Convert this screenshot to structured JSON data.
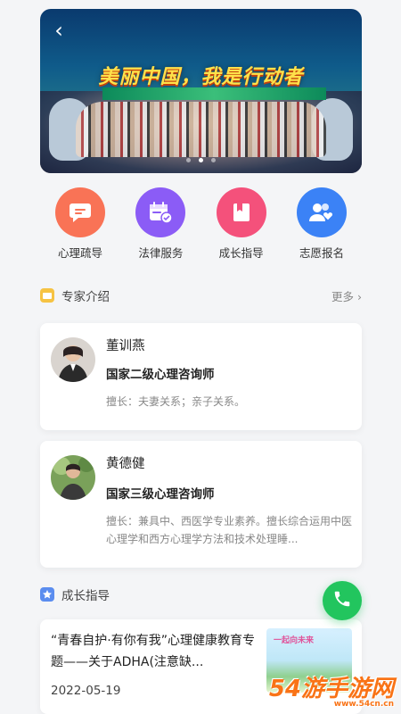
{
  "banner": {
    "title": "美丽中国，我是行动者",
    "back_icon": "chevron-left-icon",
    "slides": 3,
    "active_slide": 2
  },
  "services": [
    {
      "label": "心理疏导",
      "icon": "chat-bubble-icon",
      "color": "#f97356"
    },
    {
      "label": "法律服务",
      "icon": "calendar-check-icon",
      "color": "#8b5cf6"
    },
    {
      "label": "成长指导",
      "icon": "book-icon",
      "color": "#f4517b"
    },
    {
      "label": "志愿报名",
      "icon": "users-heart-icon",
      "color": "#3b82f6"
    }
  ],
  "experts_section": {
    "title": "专家介绍",
    "more": "更多",
    "icon_color": "#f6c343"
  },
  "experts": [
    {
      "name": "董训燕",
      "role": "国家二级心理咨询师",
      "desc": "擅长：夫妻关系；亲子关系。"
    },
    {
      "name": "黄德健",
      "role": "国家三级心理咨询师",
      "desc": "擅长：兼具中、西医学专业素养。擅长综合运用中医心理学和西方心理学方法和技术处理睡..."
    }
  ],
  "growth_section": {
    "title": "成长指导",
    "icon_color": "#5b8def"
  },
  "articles": [
    {
      "title": "“青春自护·有你有我”心理健康教育专题——关于ADHA(注意缺...",
      "date": "2022-05-19",
      "thumb_caption": "一起向未来"
    }
  ],
  "fab": {
    "icon": "phone-icon",
    "color": "#22c55e"
  },
  "watermark": {
    "text": "54游手游网",
    "sub": "www.54cn.cn"
  }
}
